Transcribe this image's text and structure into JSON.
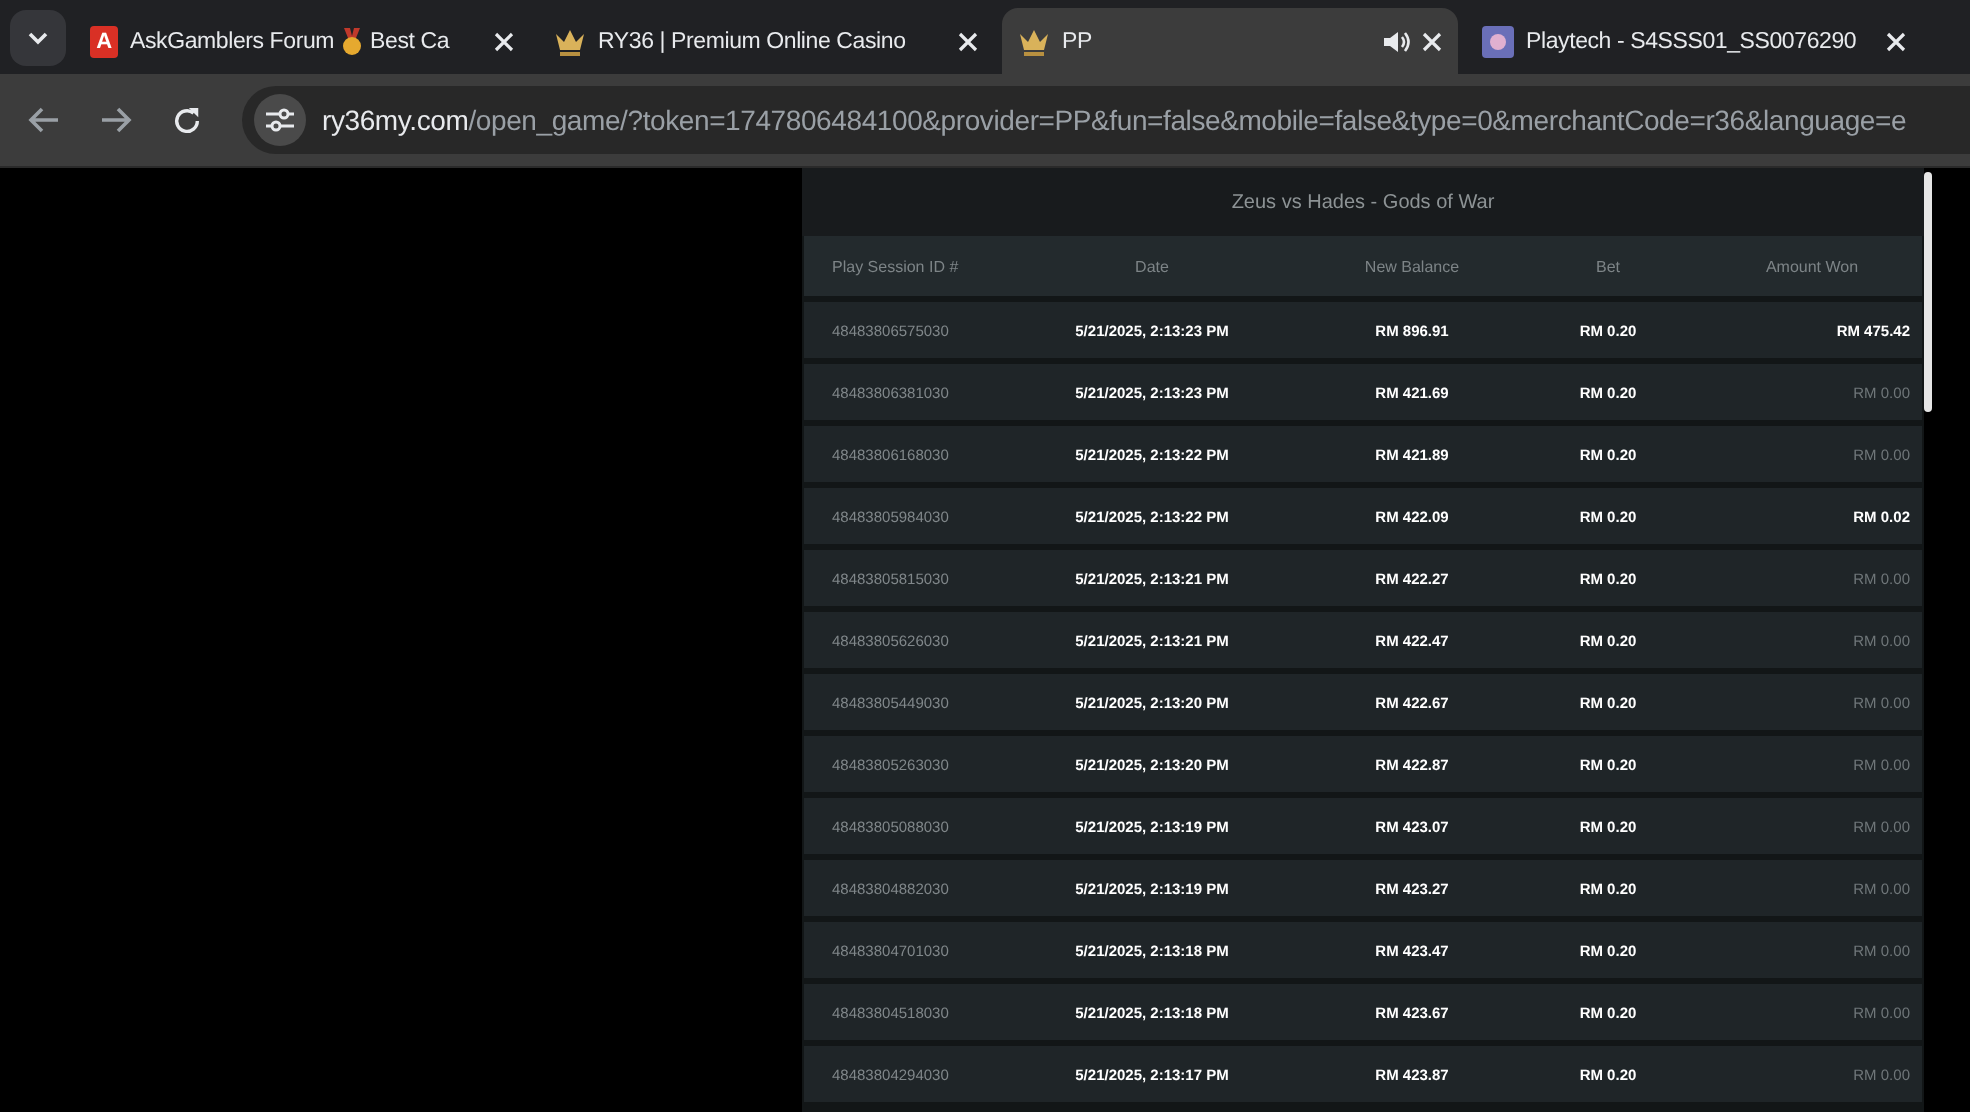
{
  "tabs": [
    {
      "title": "AskGamblers Forum",
      "title_suffix": "Best Ca",
      "kind": "letter",
      "favicon_text": "A",
      "selected": false,
      "audio": false
    },
    {
      "title": "RY36 | Premium Online Casino",
      "kind": "crown",
      "selected": false,
      "audio": false
    },
    {
      "title": "PP",
      "kind": "crown",
      "selected": true,
      "audio": true
    },
    {
      "title": "Playtech - S4SSS01_SS0076290",
      "kind": "game",
      "selected": false,
      "audio": false
    }
  ],
  "address_bar": {
    "domain": "ry36my.com",
    "path": "/open_game/?token=1747806484100&provider=PP&fun=false&mobile=false&type=0&merchantCode=r36&language=e"
  },
  "history": {
    "title": "Zeus vs Hades - Gods of War",
    "columns": [
      "Play Session ID #",
      "Date",
      "New Balance",
      "Bet",
      "Amount Won"
    ],
    "rows": [
      {
        "session_id": "48483806575030",
        "date": "5/21/2025, 2:13:23 PM",
        "new_balance": "RM 896.91",
        "bet": "RM 0.20",
        "amount_won": "RM 475.42",
        "won": true
      },
      {
        "session_id": "48483806381030",
        "date": "5/21/2025, 2:13:23 PM",
        "new_balance": "RM 421.69",
        "bet": "RM 0.20",
        "amount_won": "RM 0.00",
        "won": false
      },
      {
        "session_id": "48483806168030",
        "date": "5/21/2025, 2:13:22 PM",
        "new_balance": "RM 421.89",
        "bet": "RM 0.20",
        "amount_won": "RM 0.00",
        "won": false
      },
      {
        "session_id": "48483805984030",
        "date": "5/21/2025, 2:13:22 PM",
        "new_balance": "RM 422.09",
        "bet": "RM 0.20",
        "amount_won": "RM 0.02",
        "won": true
      },
      {
        "session_id": "48483805815030",
        "date": "5/21/2025, 2:13:21 PM",
        "new_balance": "RM 422.27",
        "bet": "RM 0.20",
        "amount_won": "RM 0.00",
        "won": false
      },
      {
        "session_id": "48483805626030",
        "date": "5/21/2025, 2:13:21 PM",
        "new_balance": "RM 422.47",
        "bet": "RM 0.20",
        "amount_won": "RM 0.00",
        "won": false
      },
      {
        "session_id": "48483805449030",
        "date": "5/21/2025, 2:13:20 PM",
        "new_balance": "RM 422.67",
        "bet": "RM 0.20",
        "amount_won": "RM 0.00",
        "won": false
      },
      {
        "session_id": "48483805263030",
        "date": "5/21/2025, 2:13:20 PM",
        "new_balance": "RM 422.87",
        "bet": "RM 0.20",
        "amount_won": "RM 0.00",
        "won": false
      },
      {
        "session_id": "48483805088030",
        "date": "5/21/2025, 2:13:19 PM",
        "new_balance": "RM 423.07",
        "bet": "RM 0.20",
        "amount_won": "RM 0.00",
        "won": false
      },
      {
        "session_id": "48483804882030",
        "date": "5/21/2025, 2:13:19 PM",
        "new_balance": "RM 423.27",
        "bet": "RM 0.20",
        "amount_won": "RM 0.00",
        "won": false
      },
      {
        "session_id": "48483804701030",
        "date": "5/21/2025, 2:13:18 PM",
        "new_balance": "RM 423.47",
        "bet": "RM 0.20",
        "amount_won": "RM 0.00",
        "won": false
      },
      {
        "session_id": "48483804518030",
        "date": "5/21/2025, 2:13:18 PM",
        "new_balance": "RM 423.67",
        "bet": "RM 0.20",
        "amount_won": "RM 0.00",
        "won": false
      },
      {
        "session_id": "48483804294030",
        "date": "5/21/2025, 2:13:17 PM",
        "new_balance": "RM 423.87",
        "bet": "RM 0.20",
        "amount_won": "RM 0.00",
        "won": false
      }
    ]
  }
}
